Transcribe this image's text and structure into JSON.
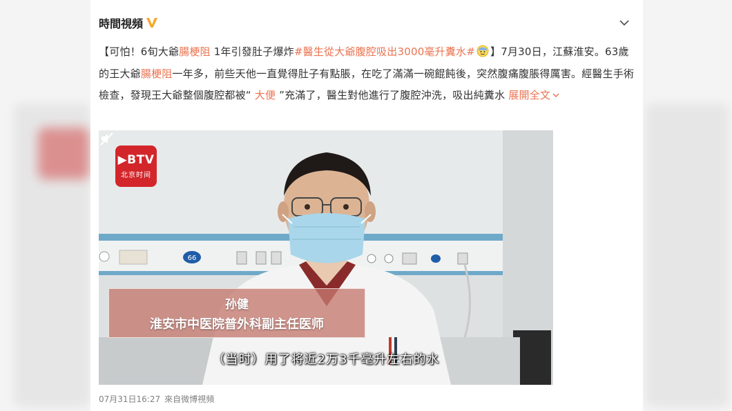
{
  "post": {
    "author": "時間視頻",
    "text": {
      "p1": "【可怕！6旬大爺",
      "kw1": "腸梗阻",
      "p2": " 1年引發肚子爆炸",
      "tag": "#醫生從大爺腹腔吸出3000毫升糞水#",
      "p3": "】7月30日，江蘇淮安。63歲的王大爺",
      "kw2": "腸梗阻",
      "p4": "一年多，前些天他一直覺得肚子有點脹，在吃了滿滿一碗餛飩後，突然腹痛腹脹得厲害。經醫生手術檢查，發現王大爺整個腹腔都被“",
      "kw3": " 大便 ",
      "p5": "”充滿了，醫生對他進行了腹腔沖洗，吸出純糞水 ",
      "expand": "展開全文"
    },
    "icons": {
      "verified": "verified-v-icon",
      "more": "chevron-down-icon",
      "emoji": "sweat-emoji-icon",
      "mute": "mute-icon"
    },
    "colors": {
      "accent": "#eb7350",
      "btv_red": "#d3262a",
      "verified": "#f5a623"
    }
  },
  "video": {
    "logo_main": "▶BTV",
    "logo_sub": "北京时间",
    "lower_third_name": "孙健",
    "lower_third_title": "淮安市中医院普外科副主任医师",
    "subtitle": "（当时）用了将近2万3千毫升左右的水",
    "wall_badge": "66"
  },
  "footer": {
    "time": "07月31日16:27",
    "source": "來自微博視頻"
  }
}
